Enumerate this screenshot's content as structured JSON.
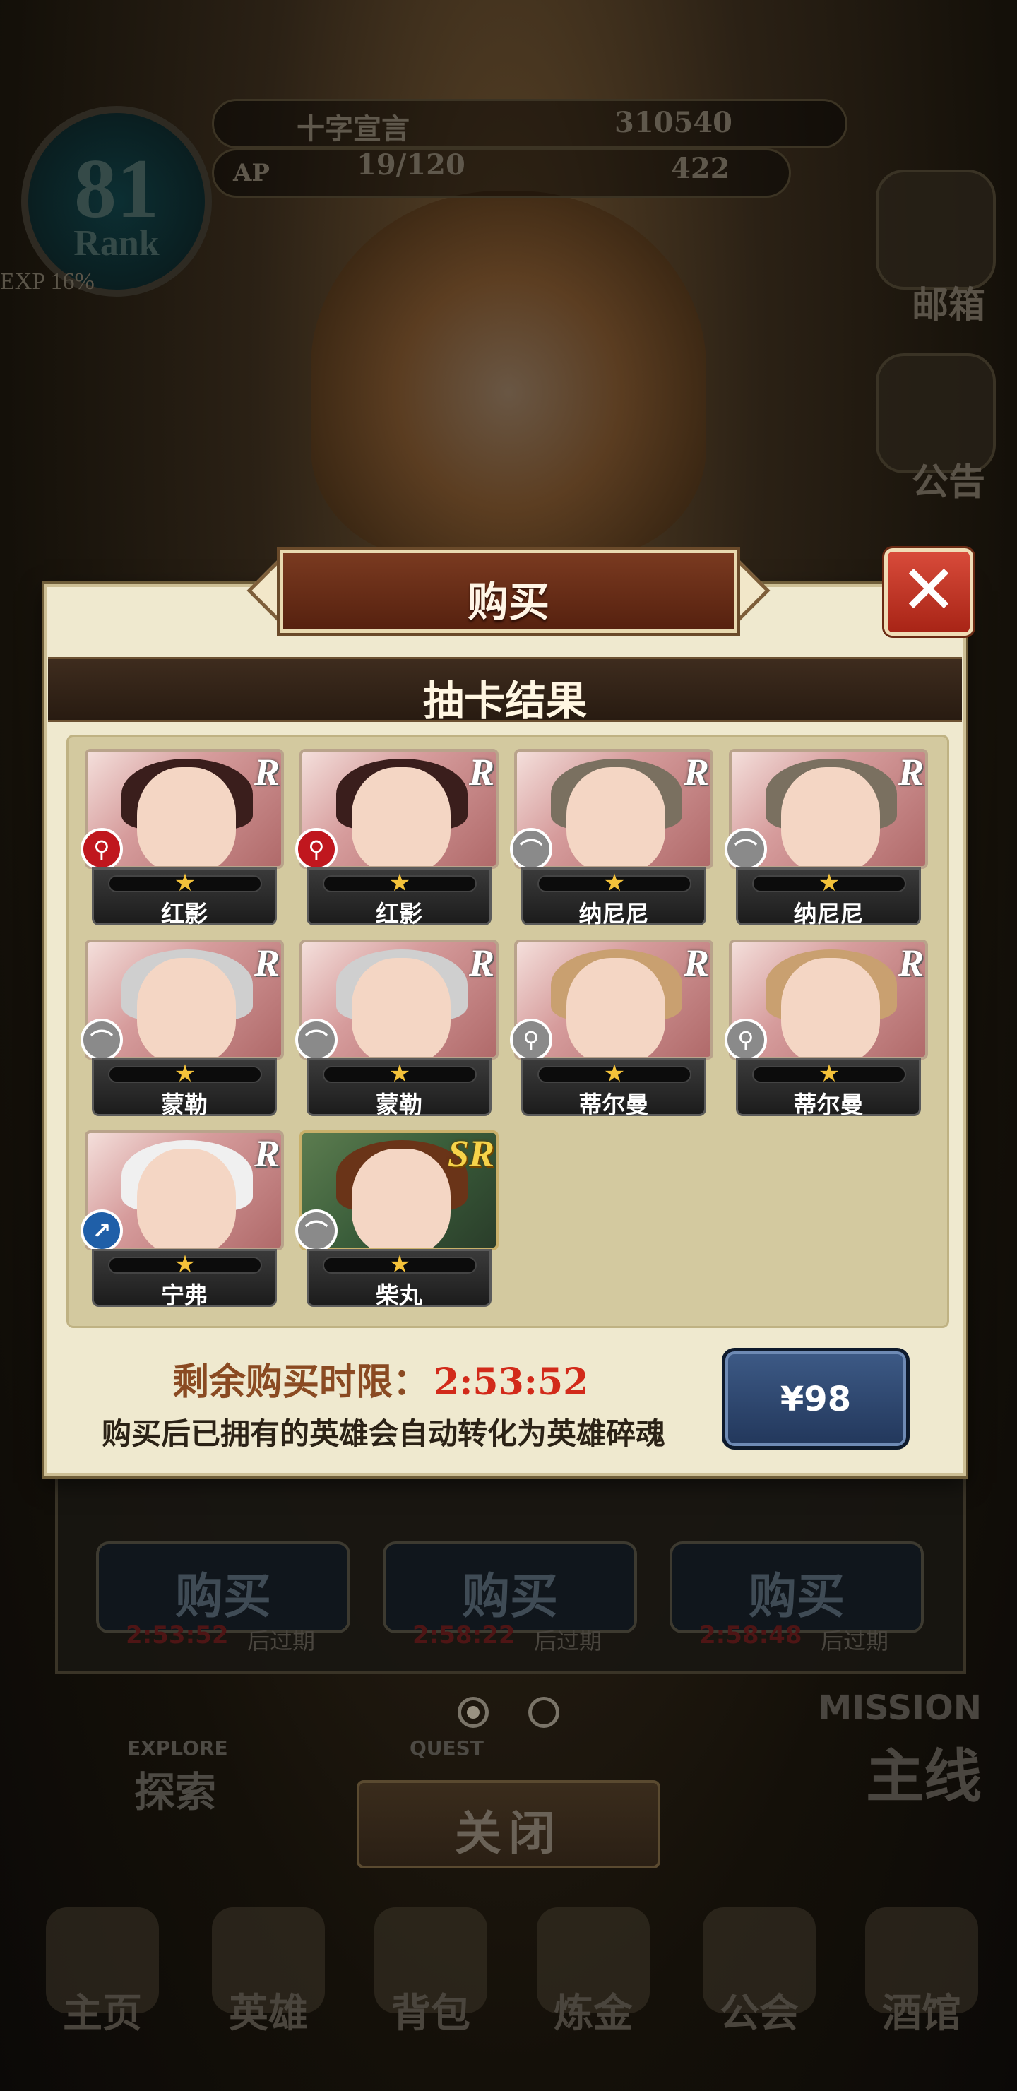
{
  "background": {
    "hud": {
      "player_name": "十字宣言",
      "currency_gold": "310540",
      "ap_label": "AP",
      "ap_value": "19/120",
      "currency_gems": "422",
      "rank_number": "81",
      "rank_label": "Rank",
      "exp_label": "EXP 16%"
    },
    "side_buttons": {
      "mailbox_label": "邮箱",
      "notice_label": "公告"
    },
    "old_panel": {
      "buttons": [
        {
          "label": "购买",
          "time": "2:53:52",
          "suffix": "后过期"
        },
        {
          "label": "购买",
          "time": "2:58:22",
          "suffix": "后过期"
        },
        {
          "label": "购买",
          "time": "2:58:48",
          "suffix": "后过期"
        }
      ]
    },
    "explore_label": "探索",
    "explore_en": "EXPLORE",
    "quest_en": "QUEST",
    "mission_en": "MISSION",
    "mission_label": "主线",
    "close_label": "关闭",
    "nav": [
      {
        "label": "主页"
      },
      {
        "label": "英雄"
      },
      {
        "label": "背包"
      },
      {
        "label": "炼金"
      },
      {
        "label": "公会"
      },
      {
        "label": "酒馆"
      }
    ]
  },
  "dialog": {
    "title": "购买",
    "close_icon": "close-x-icon",
    "section_title": "抽卡结果",
    "cards": [
      {
        "name": "红影",
        "rarity": "R",
        "stars": "★",
        "type_icon": "staff-icon",
        "type_color": "#c0171e"
      },
      {
        "name": "红影",
        "rarity": "R",
        "stars": "★",
        "type_icon": "staff-icon",
        "type_color": "#c0171e"
      },
      {
        "name": "纳尼尼",
        "rarity": "R",
        "stars": "★",
        "type_icon": "bow-icon",
        "type_color": "#8a8a8a"
      },
      {
        "name": "纳尼尼",
        "rarity": "R",
        "stars": "★",
        "type_icon": "bow-icon",
        "type_color": "#8a8a8a"
      },
      {
        "name": "蒙勒",
        "rarity": "R",
        "stars": "★",
        "type_icon": "bow-icon",
        "type_color": "#8a8a8a"
      },
      {
        "name": "蒙勒",
        "rarity": "R",
        "stars": "★",
        "type_icon": "bow-icon",
        "type_color": "#8a8a8a"
      },
      {
        "name": "蒂尔曼",
        "rarity": "R",
        "stars": "★",
        "type_icon": "staff-icon",
        "type_color": "#8a8a8a"
      },
      {
        "name": "蒂尔曼",
        "rarity": "R",
        "stars": "★",
        "type_icon": "staff-icon",
        "type_color": "#8a8a8a"
      },
      {
        "name": "宁弗",
        "rarity": "R",
        "stars": "★",
        "type_icon": "spear-icon",
        "type_color": "#1f5fa8"
      },
      {
        "name": "柴丸",
        "rarity": "SR",
        "stars": "★",
        "type_icon": "bow-icon",
        "type_color": "#8a8a8a"
      }
    ],
    "timer_label": "剩余购买时限：",
    "timer_value": "2:53:52",
    "note": "购买后已拥有的英雄会自动转化为英雄碎魂",
    "price_label": "¥98"
  }
}
